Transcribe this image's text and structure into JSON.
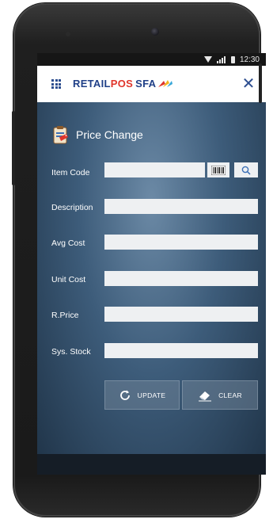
{
  "statusbar": {
    "time": "12:30"
  },
  "app": {
    "brand_part1": "RETAIL",
    "brand_part2": "POS",
    "brand_part3": "SFA"
  },
  "screen": {
    "title": "Price Change"
  },
  "fields": [
    {
      "label": "Item Code",
      "value": ""
    },
    {
      "label": "Description",
      "value": ""
    },
    {
      "label": "Avg Cost",
      "value": ""
    },
    {
      "label": "Unit Cost",
      "value": ""
    },
    {
      "label": "R.Price",
      "value": ""
    },
    {
      "label": "Sys. Stock",
      "value": ""
    }
  ],
  "actions": {
    "update_label": "UPDATE",
    "clear_label": "CLEAR"
  },
  "icons": {
    "menu": "grid-menu-icon",
    "close": "close-icon",
    "title": "price-tag-clipboard-icon",
    "barcode": "barcode-icon",
    "search": "search-icon",
    "update": "refresh-icon",
    "clear": "eraser-icon"
  },
  "colors": {
    "brand_blue": "#1f3f87",
    "brand_red": "#e0352b",
    "screen_bg": "#3d5c7a"
  }
}
